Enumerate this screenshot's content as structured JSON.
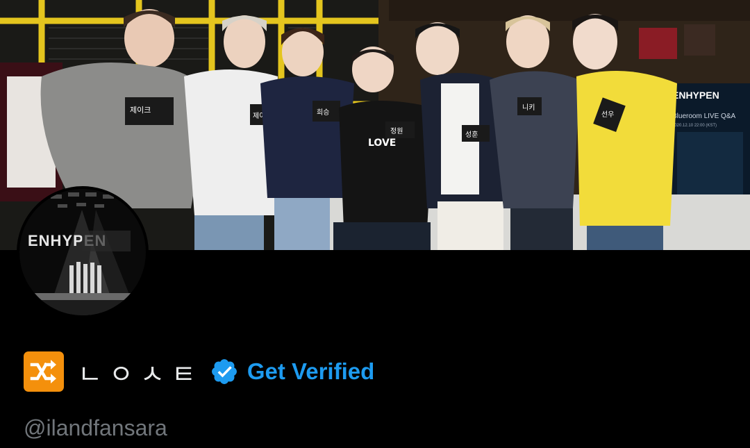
{
  "profile": {
    "display_name": "ㄴㅇㅅㅌ",
    "get_verified_label": "Get Verified",
    "handle": "@ilandfansara"
  },
  "banner": {
    "screen_title": "ENHYPEN",
    "screen_subtitle": "Blueroom LIVE Q&A",
    "screen_date": "2020.12.10 22:00 (KST)",
    "name_tags": [
      "제이크",
      "제이",
      "희승",
      "정원",
      "성훈",
      "니키",
      "선우"
    ],
    "sweater_text": "LOVE"
  },
  "avatar": {
    "logo_text": "ENHYPEN"
  },
  "colors": {
    "background": "#000000",
    "accent_blue": "#1d9bf0",
    "handle_gray": "#71767b",
    "shuffle_orange": "#f4900c",
    "name_white": "#e7e9ea"
  },
  "icons": {
    "shuffle": "shuffle-icon",
    "verified": "verified-badge-icon"
  }
}
